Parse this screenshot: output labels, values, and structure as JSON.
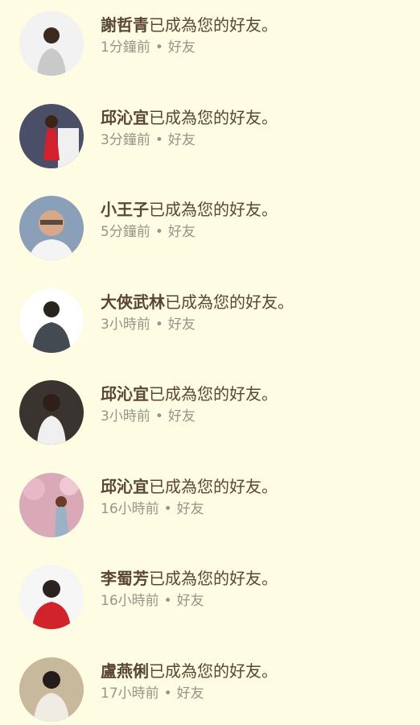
{
  "notifications": [
    {
      "name": "謝哲青",
      "action": "已成為您的好友。",
      "time": "1分鐘前",
      "category": "好友",
      "avatar_bg": "#f2f2f2",
      "avatar_fg": "#c9c9c9"
    },
    {
      "name": "邱沁宜",
      "action": "已成為您的好友。",
      "time": "3分鐘前",
      "category": "好友",
      "avatar_bg": "#4a4e66",
      "avatar_fg": "#d2202c"
    },
    {
      "name": "小王子",
      "action": "已成為您的好友。",
      "time": "5分鐘前",
      "category": "好友",
      "avatar_bg": "#8aa0b8",
      "avatar_fg": "#f4f4f4"
    },
    {
      "name": "大俠武林",
      "action": "已成為您的好友。",
      "time": "3小時前",
      "category": "好友",
      "avatar_bg": "#ffffff",
      "avatar_fg": "#444a52"
    },
    {
      "name": "邱沁宜",
      "action": "已成為您的好友。",
      "time": "3小時前",
      "category": "好友",
      "avatar_bg": "#3a3430",
      "avatar_fg": "#f0f0f0"
    },
    {
      "name": "邱沁宜",
      "action": "已成為您的好友。",
      "time": "16小時前",
      "category": "好友",
      "avatar_bg": "#d9a9b8",
      "avatar_fg": "#9ab2c4"
    },
    {
      "name": "李蜀芳",
      "action": "已成為您的好友。",
      "time": "16小時前",
      "category": "好友",
      "avatar_bg": "#f6f6f6",
      "avatar_fg": "#d0242a"
    },
    {
      "name": "盧燕俐",
      "action": "已成為您的好友。",
      "time": "17小時前",
      "category": "好友",
      "avatar_bg": "#c8b89c",
      "avatar_fg": "#f0ece4"
    }
  ]
}
